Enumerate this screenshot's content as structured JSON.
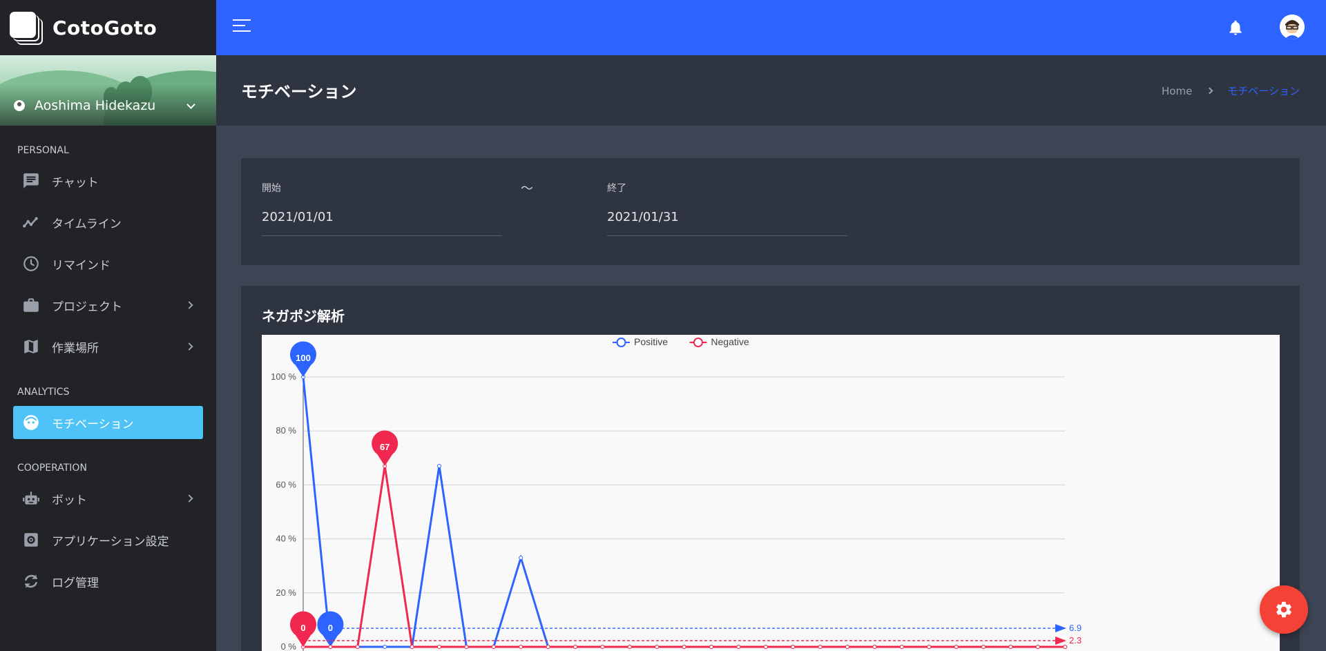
{
  "brand": {
    "name": "CotoGoto"
  },
  "user": {
    "name": "Aoshima Hidekazu"
  },
  "sidebar": {
    "sections": [
      {
        "title": "PERSONAL",
        "items": [
          {
            "label": "チャット",
            "icon": "chat-icon",
            "has_arrow": false
          },
          {
            "label": "タイムライン",
            "icon": "timeline-icon",
            "has_arrow": false
          },
          {
            "label": "リマインド",
            "icon": "clock-icon",
            "has_arrow": false
          },
          {
            "label": "プロジェクト",
            "icon": "briefcase-icon",
            "has_arrow": true
          },
          {
            "label": "作業場所",
            "icon": "map-icon",
            "has_arrow": true
          }
        ]
      },
      {
        "title": "ANALYTICS",
        "items": [
          {
            "label": "モチベーション",
            "icon": "face-icon",
            "has_arrow": false,
            "active": true
          }
        ]
      },
      {
        "title": "COOPERATION",
        "items": [
          {
            "label": "ボット",
            "icon": "robot-icon",
            "has_arrow": true
          },
          {
            "label": "アプリケーション設定",
            "icon": "settings-box-icon",
            "has_arrow": false
          },
          {
            "label": "ログ管理",
            "icon": "sync-icon",
            "has_arrow": false
          }
        ]
      }
    ]
  },
  "header": {
    "menu_icon": "menu-icon",
    "notification_icon": "bell-icon",
    "avatar_icon": "avatar-icon"
  },
  "page": {
    "title": "モチベーション",
    "breadcrumb": {
      "home": "Home",
      "current": "モチベーション"
    }
  },
  "filter": {
    "start_label": "開始",
    "start_value": "2021/01/01",
    "separator": "〜",
    "end_label": "終了",
    "end_value": "2021/01/31"
  },
  "chart_section": {
    "title": "ネガポジ解析"
  },
  "chart_data": {
    "type": "line",
    "title": "",
    "ylabel": "",
    "xlabel": "",
    "y_unit": " %",
    "ylim": [
      0,
      100
    ],
    "yticks": [
      0,
      20,
      40,
      60,
      80,
      100
    ],
    "grid": true,
    "legend": "top-center",
    "x": [
      1,
      2,
      3,
      4,
      5,
      6,
      7,
      8,
      9,
      10,
      11,
      12,
      13,
      14,
      15,
      16,
      17,
      18,
      19,
      20,
      21,
      22,
      23,
      24,
      25,
      26,
      27,
      28,
      29
    ],
    "series": [
      {
        "name": "Positive",
        "color": "#2d63ff",
        "values": [
          100,
          0,
          0,
          0,
          0,
          67,
          0,
          0,
          33,
          0,
          0,
          0,
          0,
          0,
          0,
          0,
          0,
          0,
          0,
          0,
          0,
          0,
          0,
          0,
          0,
          0,
          0,
          0,
          0
        ],
        "mark_points": [
          {
            "x": 1,
            "label": "100"
          },
          {
            "x": 2,
            "label": "0"
          }
        ],
        "average": 6.9
      },
      {
        "name": "Negative",
        "color": "#f0284f",
        "values": [
          0,
          0,
          0,
          67,
          0,
          0,
          0,
          0,
          0,
          0,
          0,
          0,
          0,
          0,
          0,
          0,
          0,
          0,
          0,
          0,
          0,
          0,
          0,
          0,
          0,
          0,
          0,
          0,
          0
        ],
        "mark_points": [
          {
            "x": 1,
            "label": "0"
          },
          {
            "x": 4,
            "label": "67"
          }
        ],
        "average": 2.3
      }
    ]
  },
  "fab": {
    "icon": "gear-icon"
  }
}
